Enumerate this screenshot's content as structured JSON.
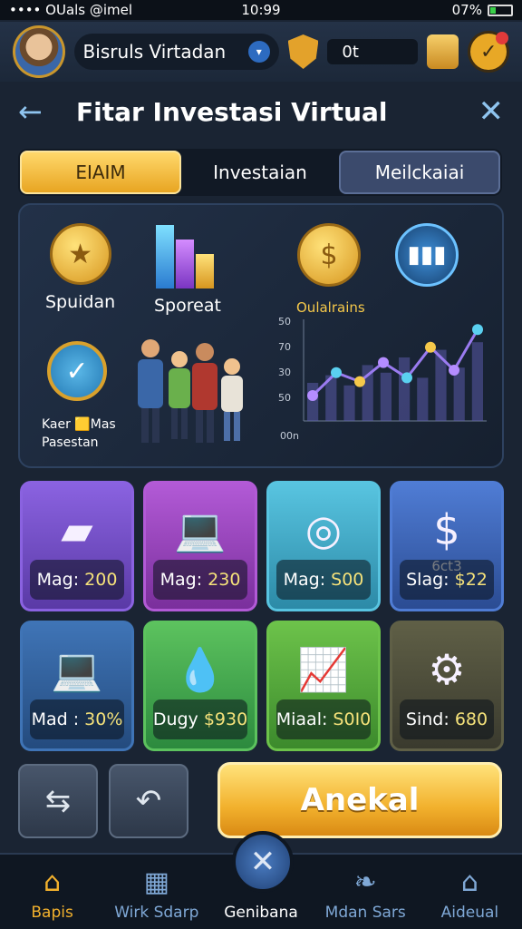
{
  "status": {
    "left": "•••• OUals @imel",
    "time": "10:99",
    "right": "07%"
  },
  "profile": {
    "name": "Bisruls Virtadan",
    "coins": "0t"
  },
  "header": {
    "title": "Fitar Investasi Virtual"
  },
  "tabs": [
    "EIAIM",
    "Investaian",
    "Meilckaiai"
  ],
  "panel": {
    "icons": [
      {
        "label": "Spuidan"
      },
      {
        "label": "Sporeat"
      }
    ],
    "badge_lines": [
      "Kaer 🟨Mas",
      "Pasestan"
    ],
    "chart_title": "Oulalrains",
    "chart_data": {
      "type": "line",
      "title": "Oulalrains",
      "yticks": [
        "50",
        "70",
        "30",
        "50"
      ],
      "xticks": [
        "00n"
      ],
      "values": [
        20,
        38,
        31,
        46,
        34,
        58,
        40,
        72
      ],
      "bar_values": [
        30,
        36,
        28,
        44,
        38,
        50,
        34,
        56,
        42,
        62
      ]
    }
  },
  "cards": [
    {
      "label": "Mag:",
      "value": "200",
      "bg": "#5a3aa6",
      "border": "#8a62e0",
      "art": "▰"
    },
    {
      "label": "Mag:",
      "value": "230",
      "bg": "#7a2f9c",
      "border": "#b25ad6",
      "art": "💻"
    },
    {
      "label": "Mag:",
      "value": "S00",
      "bg": "#2c8aa7",
      "border": "#58c4e0",
      "art": "◎"
    },
    {
      "label": "Slag:",
      "value": "$22",
      "sub": "6ct3",
      "bg": "#2b4c93",
      "border": "#4f7cd4",
      "art": "$"
    },
    {
      "label": "Mad :",
      "value": "30%",
      "bg": "#244b7e",
      "border": "#3f74b6",
      "art": "💻"
    },
    {
      "label": "Dugy",
      "value": "$930",
      "bg": "#2c8a3e",
      "border": "#5cc25e",
      "art": "💧"
    },
    {
      "label": "Miaal:",
      "value": "S0I0",
      "bg": "#3c8a2c",
      "border": "#6cc24a",
      "art": "📈"
    },
    {
      "label": "Sind:",
      "value": "680",
      "bg": "#3a3a2e",
      "border": "#5f5f46",
      "art": "⚙"
    }
  ],
  "cta": {
    "label": "Anekal"
  },
  "nav": [
    {
      "label": "Bapis",
      "icon": "⌂"
    },
    {
      "label": "Wirk Sdarp",
      "icon": "▦"
    },
    {
      "label": "Genibana",
      "icon": "✕"
    },
    {
      "label": "Mdan Sars",
      "icon": "❧"
    },
    {
      "label": "Aideual",
      "icon": "⌂"
    }
  ]
}
